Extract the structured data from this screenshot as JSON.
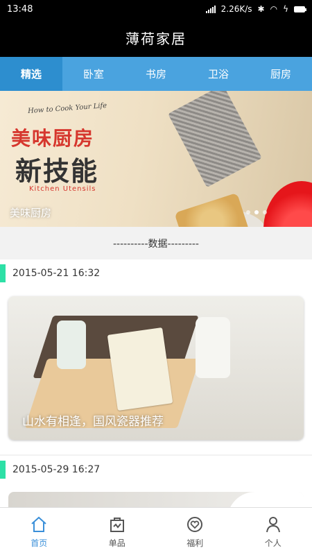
{
  "status_bar": {
    "time": "13:48",
    "net_speed": "2.26K/s"
  },
  "app": {
    "title": "薄荷家居"
  },
  "tabs": [
    {
      "label": "精选",
      "active": true
    },
    {
      "label": "卧室"
    },
    {
      "label": "书房"
    },
    {
      "label": "卫浴"
    },
    {
      "label": "厨房"
    }
  ],
  "banner": {
    "poster_top": "How to Cook Your Life",
    "poster_main1": "美味厨房",
    "poster_main2": "新技能",
    "poster_sub": "Kitchen Utensils",
    "caption": "美味厨房"
  },
  "divider": {
    "text": "----------数据---------"
  },
  "articles": [
    {
      "date": "2015-05-21 16:32",
      "title": "山水有相逢，国风瓷器推荐"
    },
    {
      "date": "2015-05-29 16:27"
    }
  ],
  "bottom_nav": [
    {
      "label": "首页",
      "icon": "home-icon",
      "active": true
    },
    {
      "label": "单品",
      "icon": "bag-icon"
    },
    {
      "label": "福利",
      "icon": "heart-badge-icon"
    },
    {
      "label": "个人",
      "icon": "person-icon"
    }
  ],
  "colors": {
    "tab_bg": "#4aa3df",
    "active_nav": "#3a8fd9",
    "accent_bar": "#2de0a6"
  }
}
